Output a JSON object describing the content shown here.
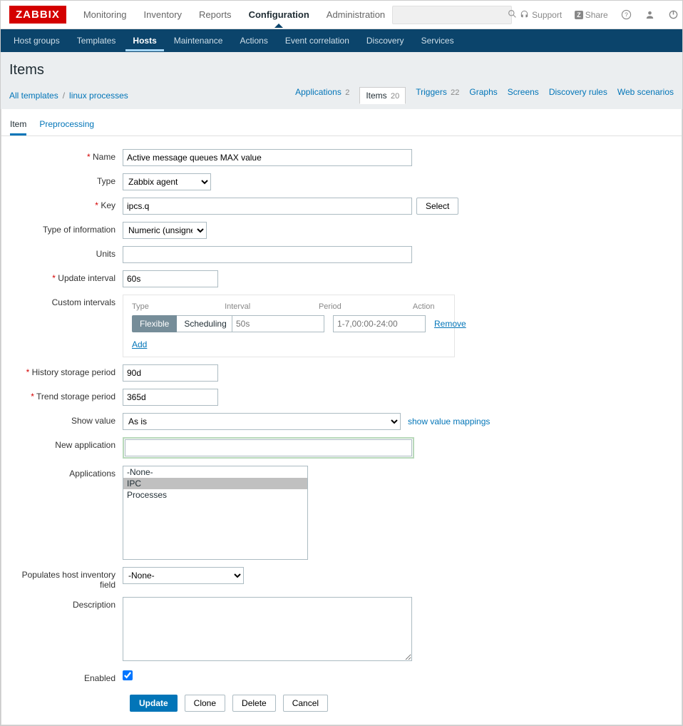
{
  "brand": "ZABBIX",
  "topnav": {
    "monitoring": "Monitoring",
    "inventory": "Inventory",
    "reports": "Reports",
    "configuration": "Configuration",
    "administration": "Administration"
  },
  "top_actions": {
    "support": "Support",
    "share": "Share",
    "share_badge": "Z"
  },
  "submenu": {
    "host_groups": "Host groups",
    "templates": "Templates",
    "hosts": "Hosts",
    "maintenance": "Maintenance",
    "actions": "Actions",
    "event_correlation": "Event correlation",
    "discovery": "Discovery",
    "services": "Services"
  },
  "page_title": "Items",
  "breadcrumb": {
    "all_templates": "All templates",
    "template": "linux processes"
  },
  "entity_tabs": {
    "applications": {
      "label": "Applications",
      "count": "2"
    },
    "items": {
      "label": "Items",
      "count": "20"
    },
    "triggers": {
      "label": "Triggers",
      "count": "22"
    },
    "graphs": "Graphs",
    "screens": "Screens",
    "discovery_rules": "Discovery rules",
    "web_scenarios": "Web scenarios"
  },
  "inner_tabs": {
    "item": "Item",
    "preprocessing": "Preprocessing"
  },
  "form": {
    "labels": {
      "name": "Name",
      "type": "Type",
      "key": "Key",
      "type_info": "Type of information",
      "units": "Units",
      "update_interval": "Update interval",
      "custom_intervals": "Custom intervals",
      "history": "History storage period",
      "trend": "Trend storage period",
      "show_value": "Show value",
      "new_app": "New application",
      "applications": "Applications",
      "populates": "Populates host inventory field",
      "description": "Description",
      "enabled": "Enabled"
    },
    "values": {
      "name": "Active message queues MAX value",
      "type": "Zabbix agent",
      "key": "ipcs.q",
      "type_info": "Numeric (unsigned)",
      "units": "",
      "update_interval": "60s",
      "history": "90d",
      "trend": "365d",
      "show_value": "As is",
      "new_app": "",
      "populates": "-None-",
      "description": "",
      "enabled": true
    },
    "key_select": "Select",
    "show_value_link": "show value mappings",
    "applications_list": [
      "-None-",
      "IPC",
      "Processes"
    ],
    "applications_selected": "IPC"
  },
  "intervals": {
    "headers": {
      "type": "Type",
      "interval": "Interval",
      "period": "Period",
      "action": "Action"
    },
    "row": {
      "flexible": "Flexible",
      "scheduling": "Scheduling",
      "interval_placeholder": "50s",
      "period_placeholder": "1-7,00:00-24:00",
      "remove": "Remove"
    },
    "add": "Add"
  },
  "buttons": {
    "update": "Update",
    "clone": "Clone",
    "delete": "Delete",
    "cancel": "Cancel"
  }
}
